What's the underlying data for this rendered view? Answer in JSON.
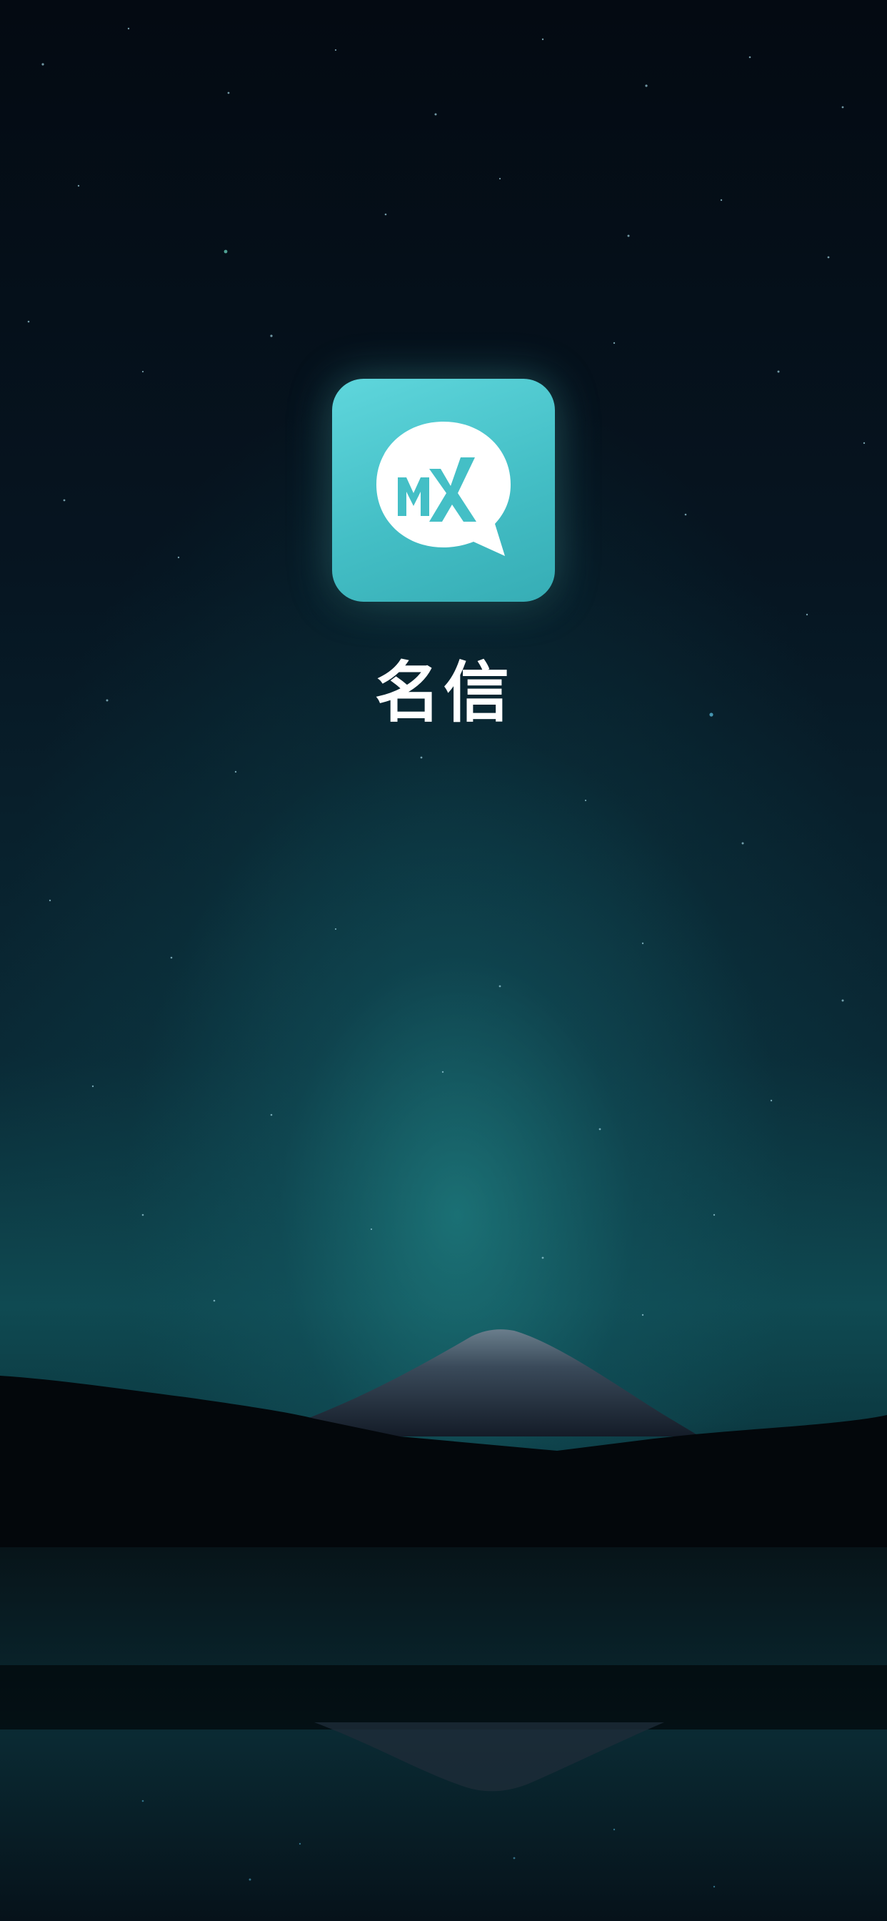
{
  "app": {
    "name": "名信",
    "logo_text": "MX",
    "icon": "speech-bubble-logo-icon"
  },
  "colors": {
    "icon_top": "#5fd6dc",
    "icon_bottom": "#36adb5",
    "sky_top": "#040a12",
    "glow": "#2a9696"
  }
}
